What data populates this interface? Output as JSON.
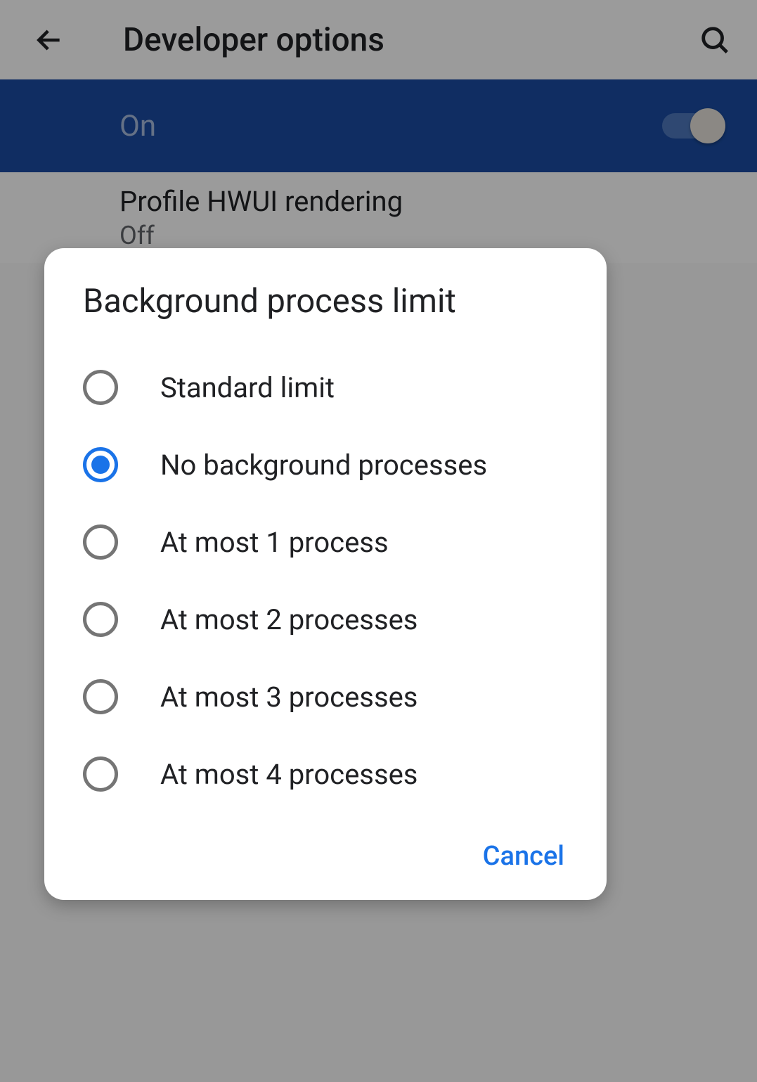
{
  "header": {
    "title": "Developer options"
  },
  "toggle": {
    "label": "On",
    "state": true
  },
  "settings_item": {
    "title": "Profile HWUI rendering",
    "subtitle": "Off"
  },
  "dialog": {
    "title": "Background process limit",
    "options": [
      {
        "label": "Standard limit",
        "selected": false
      },
      {
        "label": "No background processes",
        "selected": true
      },
      {
        "label": "At most 1 process",
        "selected": false
      },
      {
        "label": "At most 2 processes",
        "selected": false
      },
      {
        "label": "At most 3 processes",
        "selected": false
      },
      {
        "label": "At most 4 processes",
        "selected": false
      }
    ],
    "cancel_label": "Cancel"
  }
}
